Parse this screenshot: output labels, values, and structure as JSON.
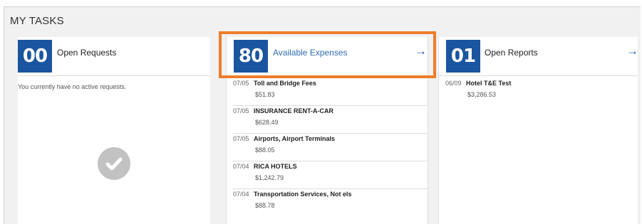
{
  "section": {
    "title": "MY TASKS"
  },
  "open_requests": {
    "count": "00",
    "label": "Open Requests",
    "empty_message": "You currently have no active requests.",
    "icon": "checkmark-circle-icon"
  },
  "available_expenses": {
    "count": "80",
    "label": "Available Expenses",
    "arrow": "→",
    "items": [
      {
        "date": "07/05",
        "name": "Toll and Bridge Fees",
        "amount": "$51.83"
      },
      {
        "date": "07/05",
        "name": "INSURANCE RENT-A-CAR",
        "amount": "$628.49"
      },
      {
        "date": "07/05",
        "name": "Airports, Airport Terminals",
        "amount": "$88.05"
      },
      {
        "date": "07/04",
        "name": "RICA HOTELS",
        "amount": "$1,242.79"
      },
      {
        "date": "07/04",
        "name": "Transportation Services, Not els",
        "amount": "$88.78"
      }
    ]
  },
  "open_reports": {
    "count": "01",
    "label": "Open Reports",
    "arrow": "→",
    "items": [
      {
        "date": "06/09",
        "name": "Hotel T&E Test",
        "amount": "$3,286.53"
      }
    ]
  },
  "colors": {
    "accent": "#1a55a0",
    "link": "#2e6db4",
    "highlight": "#ee7d2b"
  }
}
